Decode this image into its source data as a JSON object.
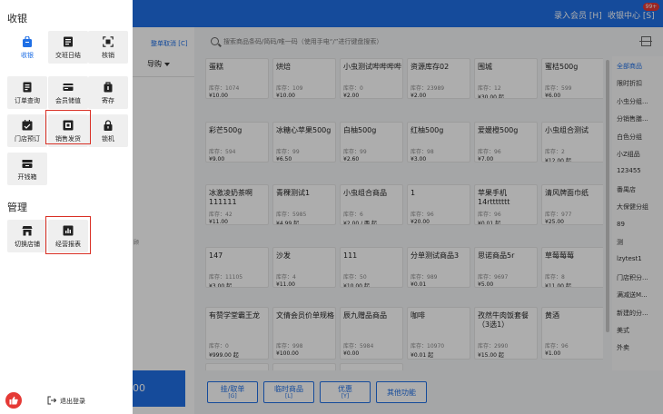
{
  "topbar": {
    "links": [
      {
        "label": "录入会员 [H]"
      },
      {
        "label": "收银中心 [S]"
      }
    ],
    "badge": "99+"
  },
  "cart": {
    "clear_label": "整单取消 [C]",
    "guide_label": "导购",
    "hint": "顾",
    "checkout_label": "00"
  },
  "search": {
    "placeholder": "搜索商品条码/简码/唯一码（使用手电“/”进行键盘搜索）"
  },
  "products": [
    {
      "name": "蛋糕",
      "stock": "库存：1074",
      "price": "¥10.00"
    },
    {
      "name": "烘焙",
      "stock": "库存：109",
      "price": "¥10.00"
    },
    {
      "name": "小虫测试哔哔哔哔",
      "stock": "库存：0",
      "price": "¥2.00"
    },
    {
      "name": "资源库存02",
      "stock": "库存：23989",
      "price": "¥2.00"
    },
    {
      "name": "围城",
      "stock": "库存：12",
      "price": "¥30.00 起"
    },
    {
      "name": "蜜桔500g",
      "stock": "库存：599",
      "price": "¥6.00"
    },
    {
      "name": "彩芒500g",
      "stock": "库存：594",
      "price": "¥9.00"
    },
    {
      "name": "冰糖心苹果500g",
      "stock": "库存：99",
      "price": "¥6.50"
    },
    {
      "name": "白柚500g",
      "stock": "库存：99",
      "price": "¥2.60"
    },
    {
      "name": "红柚500g",
      "stock": "库存：98",
      "price": "¥3.00"
    },
    {
      "name": "爱媛橙500g",
      "stock": "库存：96",
      "price": "¥7.00"
    },
    {
      "name": "小虫组合测试",
      "stock": "库存：2",
      "price": "¥12.00 起"
    },
    {
      "name": "冰激凌奶茶啊111111",
      "stock": "库存：42",
      "price": "¥11.00"
    },
    {
      "name": "青稞测试1",
      "stock": "库存：5985",
      "price": "¥4.99 起"
    },
    {
      "name": "小虫组合商品",
      "stock": "库存：6",
      "price": "¥2.00 / 两 起"
    },
    {
      "name": "1",
      "stock": "库存：96",
      "price": "¥20.00"
    },
    {
      "name": "苹果手机14rttttttt",
      "stock": "库存：96",
      "price": "¥0.01 起"
    },
    {
      "name": "清风牌面巾纸",
      "stock": "库存：977",
      "price": "¥25.00"
    },
    {
      "name": "147",
      "stock": "库存：11105",
      "price": "¥3.00 起"
    },
    {
      "name": "沙发",
      "stock": "库存：4",
      "price": "¥11.00"
    },
    {
      "name": "111",
      "stock": "库存：50",
      "price": "¥10.00 起"
    },
    {
      "name": "分单测试商品3",
      "stock": "库存：989",
      "price": "¥0.01"
    },
    {
      "name": "思诺商品5r",
      "stock": "库存：9697",
      "price": "¥5.00"
    },
    {
      "name": "草莓莓莓",
      "stock": "库存：8",
      "price": "¥11.00 起"
    },
    {
      "name": "有赞学堂霸王龙",
      "stock": "库存：0",
      "price": "¥999.00 起"
    },
    {
      "name": "文倩会员价单规格",
      "stock": "库存：998",
      "price": "¥100.00"
    },
    {
      "name": "辰九赠品商品",
      "stock": "库存：5984",
      "price": "¥0.00"
    },
    {
      "name": "咖啡",
      "stock": "库存：10970",
      "price": "¥0.01 起"
    },
    {
      "name": "孜然牛肉饭套餐（3选1）",
      "stock": "库存：2990",
      "price": "¥15.00 起"
    },
    {
      "name": "黄酒",
      "stock": "库存：96",
      "price": "¥1.00"
    }
  ],
  "categories": [
    "全部商品",
    "限时折扣",
    "小虫分组...",
    "分销售膳...",
    "白色分组",
    "小Z组品",
    "123455",
    "番禺店",
    "大保健分组",
    "89",
    "测",
    "lzytest1",
    "门店积分...",
    "满减送M...",
    "新建的分...",
    "美式",
    "外卖"
  ],
  "function_buttons": [
    {
      "label": "挂/取单",
      "key": "[G]"
    },
    {
      "label": "临时商品",
      "key": "[L]"
    },
    {
      "label": "优惠",
      "key": "[Y]"
    },
    {
      "label": "其他功能",
      "key": ""
    }
  ],
  "drawer": {
    "sections": [
      {
        "title": "收银",
        "items": [
          {
            "label": "收银",
            "icon": "shopping-bag-icon",
            "active": true
          },
          {
            "label": "交班日结",
            "icon": "shift-report-icon",
            "active": false
          },
          {
            "label": "核销",
            "icon": "scan-verify-icon",
            "active": false
          },
          {
            "label": "订单查询",
            "icon": "order-list-icon",
            "active": false
          },
          {
            "label": "会员储值",
            "icon": "member-card-icon",
            "active": false
          },
          {
            "label": "寄存",
            "icon": "locker-icon",
            "active": false
          },
          {
            "label": "门店预订",
            "icon": "store-booking-icon",
            "active": false
          },
          {
            "label": "销售发货",
            "icon": "sales-shipping-icon",
            "active": false,
            "highlighted": true
          },
          {
            "label": "锁机",
            "icon": "lock-icon",
            "active": false
          },
          {
            "label": "开钱箱",
            "icon": "cash-drawer-icon",
            "active": false
          }
        ]
      },
      {
        "title": "管理",
        "items": [
          {
            "label": "切换店铺",
            "icon": "switch-store-icon",
            "active": false
          },
          {
            "label": "经营报表",
            "icon": "business-report-icon",
            "active": false,
            "highlighted": true
          }
        ]
      }
    ],
    "logout_label": "退出登录",
    "accent_color": "#1f6fe5",
    "highlight_color": "#d93025"
  }
}
